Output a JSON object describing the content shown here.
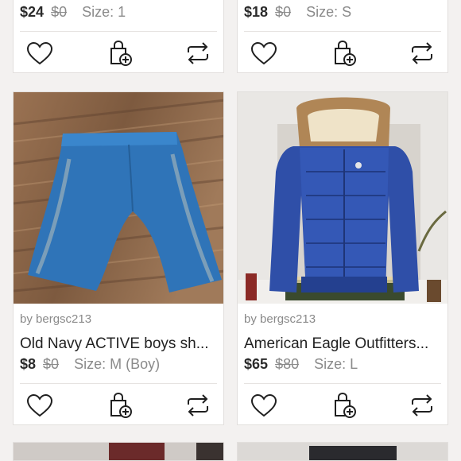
{
  "listings": [
    {
      "price": "$24",
      "original_price": "$0",
      "size": "Size: 1"
    },
    {
      "price": "$18",
      "original_price": "$0",
      "size": "Size: S"
    },
    {
      "seller": "by bergsc213",
      "title": "Old Navy ACTIVE boys sh...",
      "price": "$8",
      "original_price": "$0",
      "size": "Size: M (Boy)"
    },
    {
      "seller": "by bergsc213",
      "title": "American Eagle Outfitters...",
      "price": "$65",
      "original_price": "$80",
      "size": "Size: L"
    }
  ],
  "icons": {
    "like": "heart-icon",
    "bundle": "shopping-bag-plus-icon",
    "share": "share-repost-icon"
  },
  "colors": {
    "background": "#f3f1f0",
    "card": "#ffffff",
    "text": "#222222",
    "muted": "#8a8a8a"
  }
}
